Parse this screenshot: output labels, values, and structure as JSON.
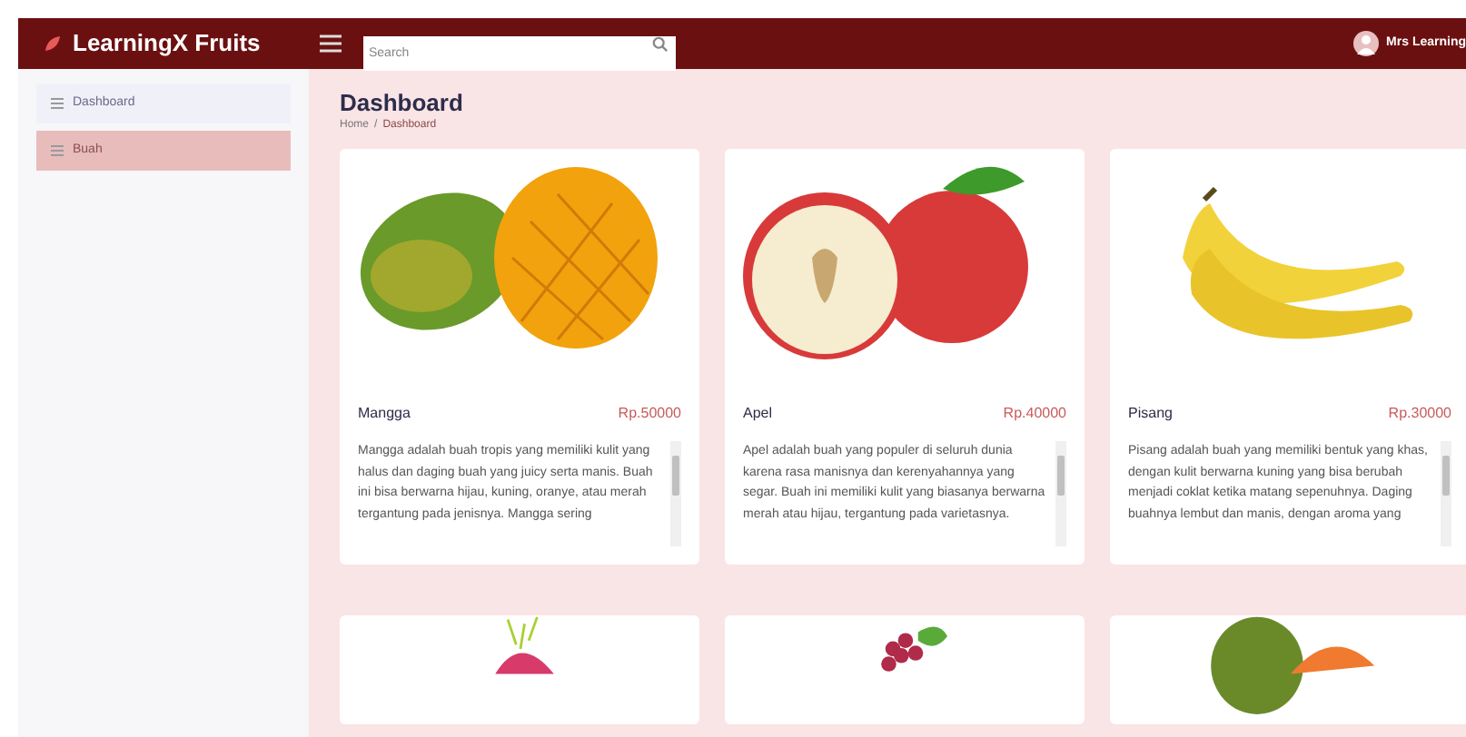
{
  "header": {
    "brand": "LearningX Fruits",
    "search": {
      "placeholder": "Search"
    },
    "user": "Mrs Learning"
  },
  "sidebar": {
    "items": [
      {
        "label": "Dashboard",
        "selected": false
      },
      {
        "label": "Buah",
        "selected": true
      }
    ]
  },
  "page": {
    "title": "Dashboard",
    "breadcrumb": {
      "items": [
        "Home",
        "Dashboard"
      ],
      "separator": "/"
    }
  },
  "cards": [
    {
      "kind": "mango",
      "name": "Mangga",
      "price": "Rp.50000",
      "description": "Mangga adalah buah tropis yang memiliki kulit yang halus dan daging buah yang juicy serta manis. Buah ini bisa berwarna hijau, kuning, oranye, atau merah tergantung pada jenisnya. Mangga sering"
    },
    {
      "kind": "apple",
      "name": "Apel",
      "price": "Rp.40000",
      "description": "Apel adalah buah yang populer di seluruh dunia karena rasa manisnya dan kerenyahannya yang segar. Buah ini memiliki kulit yang biasanya berwarna merah atau hijau, tergantung pada varietasnya."
    },
    {
      "kind": "banana",
      "name": "Pisang",
      "price": "Rp.30000",
      "description": "Pisang adalah buah yang memiliki bentuk yang khas, dengan kulit berwarna kuning yang bisa berubah menjadi coklat ketika matang sepenuhnya. Daging buahnya lembut dan manis, dengan aroma yang"
    },
    {
      "kind": "dragonfruit"
    },
    {
      "kind": "grape"
    },
    {
      "kind": "papaya"
    }
  ]
}
